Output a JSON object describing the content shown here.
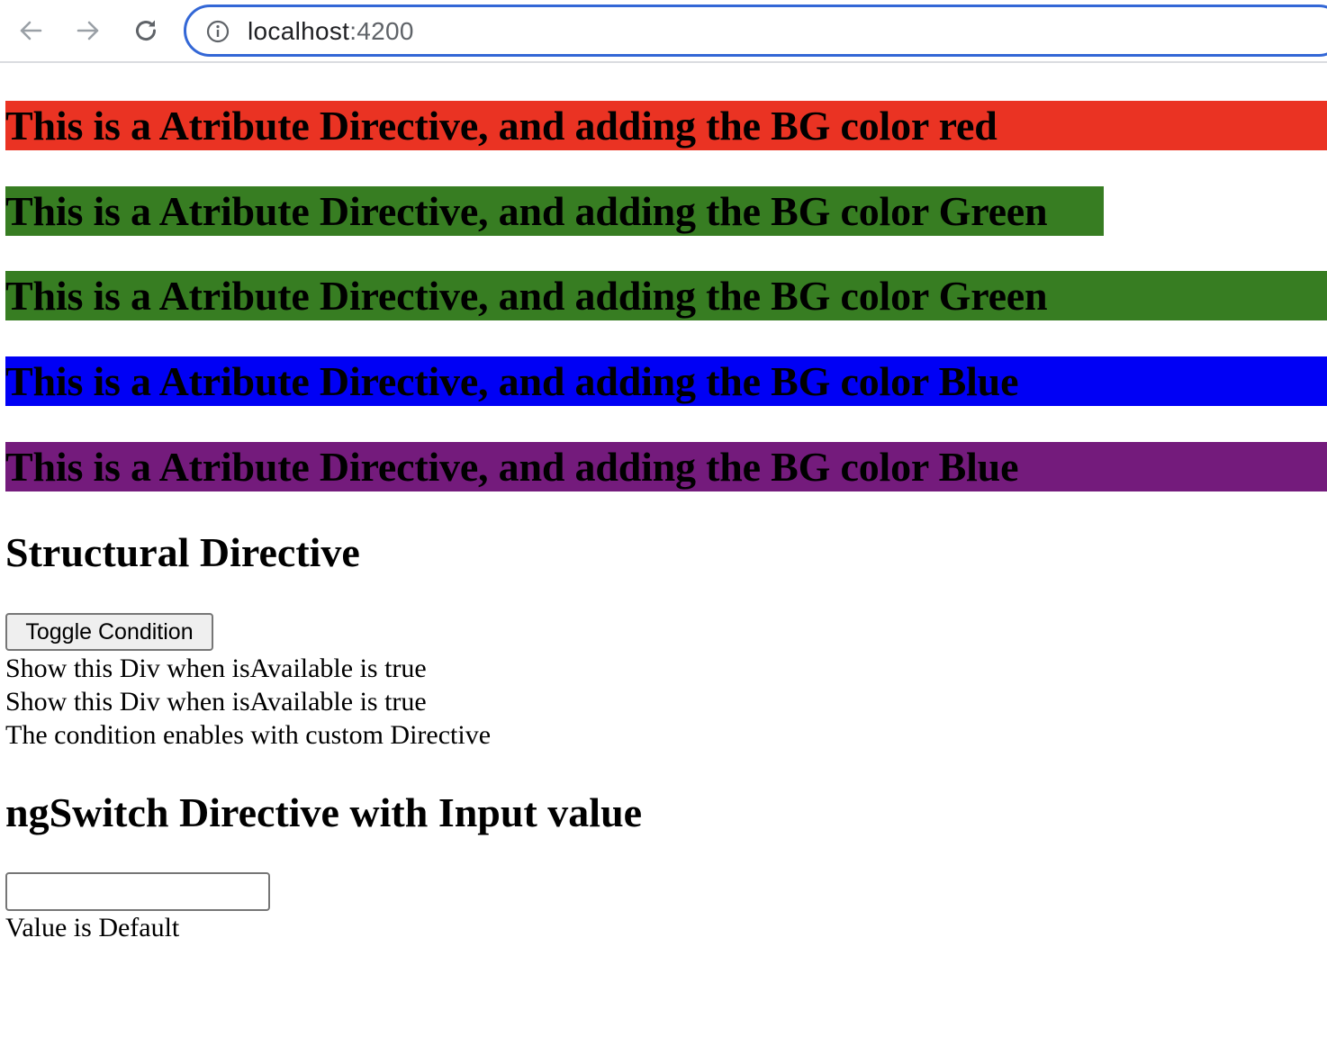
{
  "browser": {
    "url_host": "localhost",
    "url_port": ":4200",
    "icons": {
      "back": "arrow-left-icon",
      "forward": "arrow-right-icon",
      "reload": "reload-icon",
      "site_info": "info-icon"
    }
  },
  "attribute_banners": [
    {
      "text": "This is a Atribute Directive, and adding the BG color red",
      "color": "#ea3323"
    },
    {
      "text": "This is a Atribute Directive, and adding the BG color Green",
      "color": "#377d22"
    },
    {
      "text": "This is a Atribute Directive, and adding the BG color Green",
      "color": "#377d22"
    },
    {
      "text": "This is a Atribute Directive, and adding the BG color Blue",
      "color": "#0000f5"
    },
    {
      "text": "This is a Atribute Directive, and adding the BG color Blue",
      "color": "#741b7c"
    }
  ],
  "structural": {
    "heading": "Structural Directive",
    "toggle_label": "Toggle Condition",
    "lines": [
      "Show this Div when isAvailable is true",
      "Show this Div when isAvailable is true",
      "The condition enables with custom Directive"
    ]
  },
  "ngswitch": {
    "heading": "ngSwitch Directive with Input value",
    "input_value": "",
    "result": "Value is Default"
  }
}
